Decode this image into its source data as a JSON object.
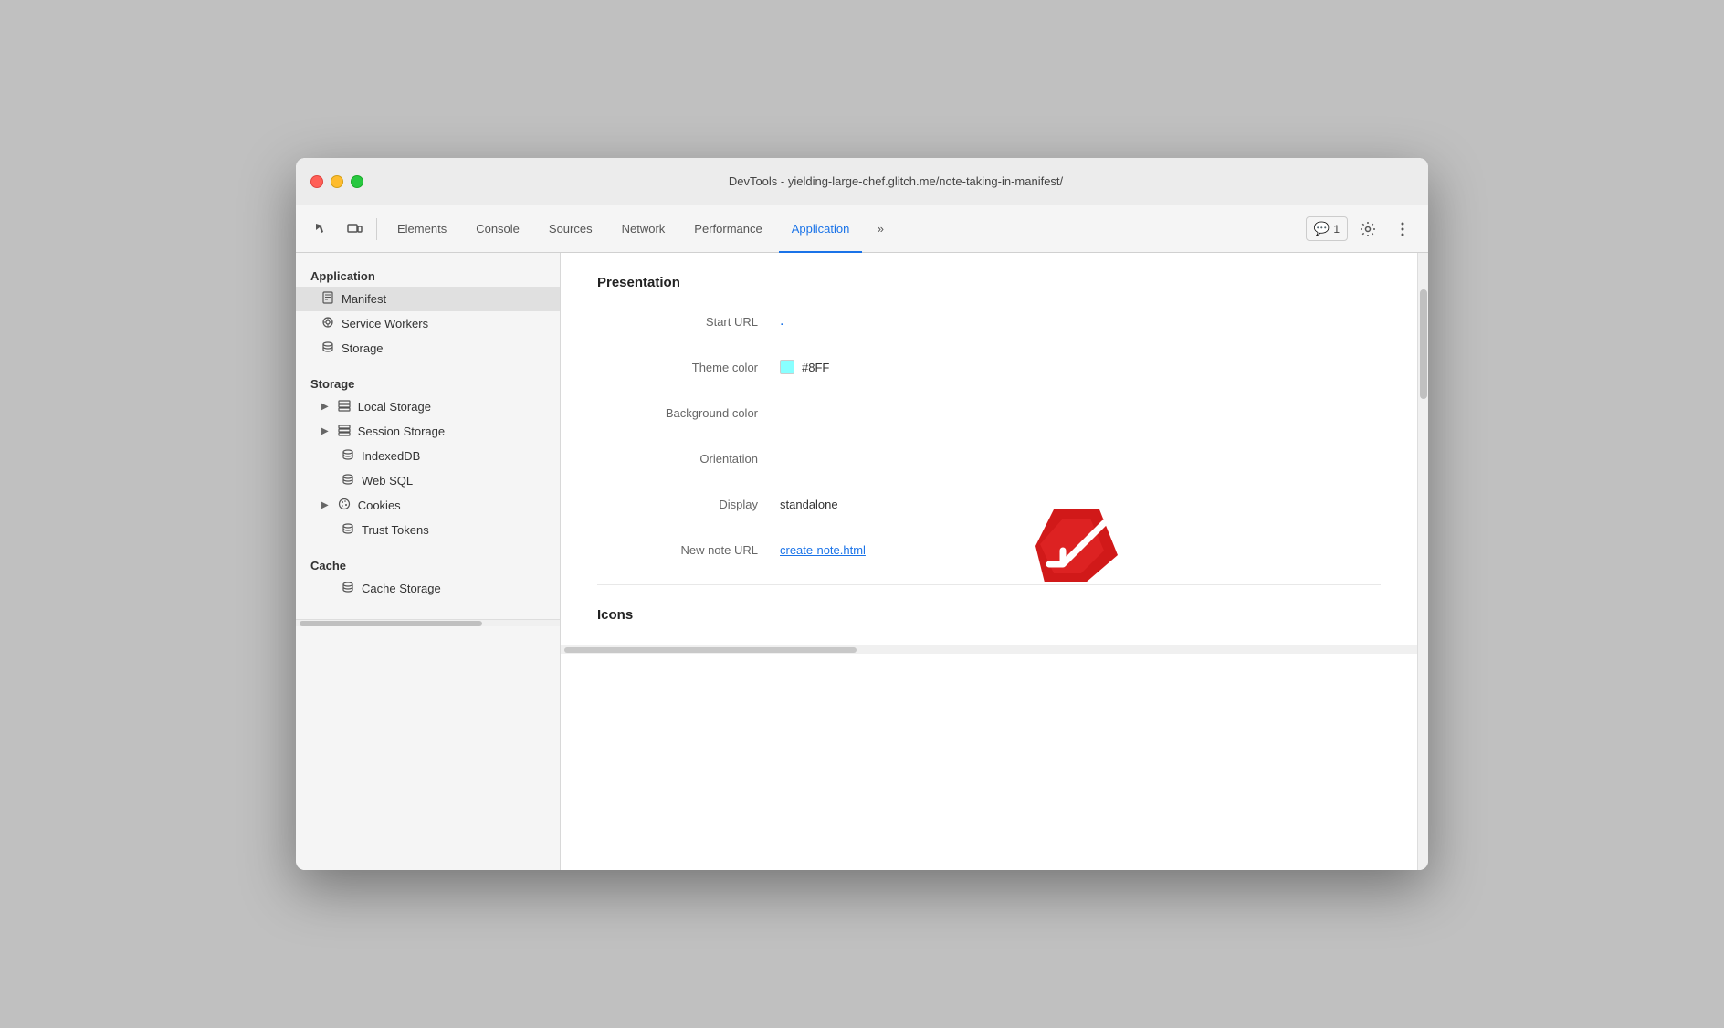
{
  "window": {
    "title": "DevTools - yielding-large-chef.glitch.me/note-taking-in-manifest/"
  },
  "toolbar": {
    "tabs": [
      {
        "label": "Elements",
        "active": false
      },
      {
        "label": "Console",
        "active": false
      },
      {
        "label": "Sources",
        "active": false
      },
      {
        "label": "Network",
        "active": false
      },
      {
        "label": "Performance",
        "active": false
      },
      {
        "label": "Application",
        "active": true
      }
    ],
    "more_tabs_label": "»",
    "messages_count": "1",
    "settings_tooltip": "Settings"
  },
  "sidebar": {
    "application_section": "Application",
    "items_application": [
      {
        "label": "Manifest",
        "icon": "📄",
        "active": true
      },
      {
        "label": "Service Workers",
        "icon": "⚙️",
        "active": false
      },
      {
        "label": "Storage",
        "icon": "🗄️",
        "active": false
      }
    ],
    "storage_section": "Storage",
    "items_storage": [
      {
        "label": "Local Storage",
        "icon": "▦",
        "has_arrow": true
      },
      {
        "label": "Session Storage",
        "icon": "▦",
        "has_arrow": true
      },
      {
        "label": "IndexedDB",
        "icon": "🗄️",
        "has_arrow": false
      },
      {
        "label": "Web SQL",
        "icon": "🗄️",
        "has_arrow": false
      },
      {
        "label": "Cookies",
        "icon": "⚙️",
        "has_arrow": true
      },
      {
        "label": "Trust Tokens",
        "icon": "🗄️",
        "has_arrow": false
      }
    ],
    "cache_section": "Cache",
    "items_cache": [
      {
        "label": "Cache Storage",
        "icon": "🗄️",
        "has_arrow": false
      }
    ]
  },
  "content": {
    "presentation_title": "Presentation",
    "rows": [
      {
        "label": "Start URL",
        "value": ".",
        "type": "dot"
      },
      {
        "label": "Theme color",
        "value": "#8FF",
        "type": "color",
        "color": "#8ff"
      },
      {
        "label": "Background color",
        "value": "",
        "type": "text"
      },
      {
        "label": "Orientation",
        "value": "",
        "type": "text"
      },
      {
        "label": "Display",
        "value": "standalone",
        "type": "text"
      },
      {
        "label": "New note URL",
        "value": "create-note.html",
        "type": "link"
      }
    ],
    "icons_title": "Icons"
  }
}
